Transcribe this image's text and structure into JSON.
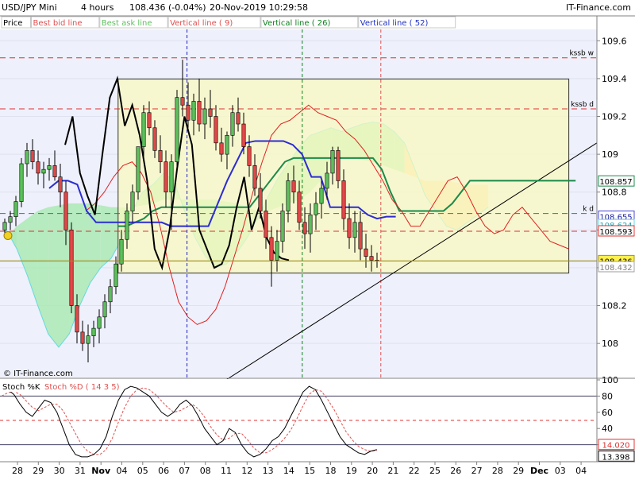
{
  "header": {
    "instrument": "USD/JPY Mini",
    "period": "4 hours",
    "price_change": "108.436 (-0.04%)",
    "datetime": "20-Nov-2019 10:29:58",
    "brand": "IT-Finance.com"
  },
  "legend": {
    "items": [
      {
        "label": "Price",
        "color": "#000000"
      },
      {
        "label": "Best bid line",
        "color": "#e05050"
      },
      {
        "label": "Best ask line",
        "color": "#60c060"
      },
      {
        "label": "Vertical line ( 9)",
        "color": "#e05050"
      },
      {
        "label": "Vertical line ( 26)",
        "color": "#108020"
      },
      {
        "label": "Vertical line ( 52)",
        "color": "#2030c0"
      }
    ]
  },
  "watermark": "© IT-Finance.com",
  "osc_legend": {
    "k_label": "Stoch %K",
    "d_label": "Stoch %D ( 14 3 5)"
  },
  "colors": {
    "plot_bg": "#eef0fb",
    "box_fill": "#fafac0",
    "box_stroke": "#333333",
    "bull": "#5cbf5c",
    "bear": "#e04848",
    "tenkan": "#e02020",
    "kijun": "#1a8a4a",
    "senkou_fill": "#a8e8b0",
    "senkou_fill_bear": "#fbd7a0",
    "chikou": "#000000",
    "span_line": "#66d9e0",
    "blue_line": "#2d2dd0",
    "current_price_line": "#a09020"
  },
  "chart_data": {
    "type": "candlestick",
    "price_scale": {
      "ylim": [
        107.82,
        109.66
      ],
      "ticks": [
        108,
        108.2,
        108.4,
        108.6,
        108.8,
        109,
        109.2,
        109.4,
        109.6
      ],
      "tick_labels": [
        "108",
        "108.2",
        "",
        "",
        "108.8",
        "109",
        "109.2",
        "109.4",
        "109.6"
      ]
    },
    "x_labels": [
      "28",
      "29",
      "30",
      "31",
      "Nov",
      "04",
      "05",
      "06",
      "07",
      "08",
      "11",
      "12",
      "13",
      "14",
      "15",
      "18",
      "19",
      "20",
      "21",
      "22",
      "25",
      "26",
      "27",
      "28",
      "29",
      "Dec",
      "03",
      "04"
    ],
    "levels": [
      {
        "label": "kssb w",
        "value": 109.51,
        "color": "#e03030",
        "dash": true
      },
      {
        "label": "kssb d",
        "value": 109.24,
        "color": "#e03030",
        "dash": true
      },
      {
        "label": "k d",
        "value": 108.687,
        "color": "#e03030",
        "dash": true
      },
      {
        "label": "",
        "value": 108.593,
        "color": "#e03030",
        "dash": true
      },
      {
        "label": "",
        "value": 108.436,
        "color": "#a09020",
        "dash": false
      }
    ],
    "price_badges": [
      {
        "text": "108.857",
        "value": 108.857,
        "color": "#ffffff",
        "border": "#1a8a4a",
        "text_color": "#000000"
      },
      {
        "text": "108.655",
        "value": 108.671,
        "color": "#ffffff",
        "border": "#4444d0",
        "text_color": "#2020a0"
      },
      {
        "text": "108.624",
        "value": 108.626,
        "color": "#ffffff",
        "border": "#66d9e0",
        "text_color": "#30a0b0"
      },
      {
        "text": "108.593",
        "value": 108.593,
        "color": "#ffffff",
        "border": "#e03030",
        "text_color": "#000000"
      },
      {
        "text": "108.436",
        "value": 108.436,
        "color": "#fff04a",
        "border": "#a09020",
        "text_color": "#000000"
      },
      {
        "text": "108.432",
        "value": 108.404,
        "color": "#ffffff",
        "border": "#a0a0a0",
        "text_color": "#808080"
      }
    ],
    "current_price": 108.436,
    "vertical_markers": [
      {
        "label": "9",
        "date_index": 26,
        "color": "#2020c0"
      },
      {
        "label": "26",
        "date_index": 48,
        "color": "#108020"
      },
      {
        "label": "52",
        "date_index": 63,
        "color": "#e05050"
      }
    ],
    "rect_zone": {
      "x_from_index": 8,
      "x_to_index": 101,
      "y_from": 108.372,
      "y_to": 109.398
    },
    "trendline": {
      "from": {
        "date_index": 6,
        "value": 107.58
      },
      "to": {
        "date_index": 106,
        "value": 109.06
      }
    },
    "candles": [
      [
        108.6,
        108.66,
        108.57,
        108.64
      ],
      [
        108.64,
        108.7,
        108.6,
        108.67
      ],
      [
        108.67,
        108.78,
        108.62,
        108.75
      ],
      [
        108.75,
        108.98,
        108.72,
        108.95
      ],
      [
        108.95,
        109.06,
        108.88,
        109.02
      ],
      [
        109.02,
        109.08,
        108.92,
        108.96
      ],
      [
        108.96,
        109.02,
        108.84,
        108.9
      ],
      [
        108.9,
        108.96,
        108.82,
        108.92
      ],
      [
        108.92,
        108.98,
        108.86,
        108.94
      ],
      [
        108.94,
        109.02,
        108.86,
        108.88
      ],
      [
        108.88,
        108.95,
        108.72,
        108.8
      ],
      [
        108.8,
        108.86,
        108.52,
        108.6
      ],
      [
        108.6,
        108.64,
        108.16,
        108.2
      ],
      [
        108.2,
        108.26,
        108.0,
        108.06
      ],
      [
        108.06,
        108.12,
        107.96,
        108.0
      ],
      [
        108.0,
        108.1,
        107.9,
        108.04
      ],
      [
        108.04,
        108.12,
        107.98,
        108.08
      ],
      [
        108.08,
        108.18,
        108.0,
        108.14
      ],
      [
        108.14,
        108.26,
        108.08,
        108.22
      ],
      [
        108.22,
        108.34,
        108.16,
        108.3
      ],
      [
        108.3,
        108.46,
        108.26,
        108.42
      ],
      [
        108.42,
        108.6,
        108.38,
        108.55
      ],
      [
        108.55,
        108.74,
        108.5,
        108.7
      ],
      [
        108.7,
        108.84,
        108.64,
        108.8
      ],
      [
        108.8,
        109.0,
        108.76,
        109.04
      ],
      [
        109.04,
        109.26,
        108.98,
        109.22
      ],
      [
        109.22,
        109.28,
        109.1,
        109.14
      ],
      [
        109.14,
        109.18,
        108.98,
        109.02
      ],
      [
        109.02,
        109.1,
        108.9,
        108.96
      ],
      [
        108.96,
        109.02,
        108.72,
        108.8
      ],
      [
        108.8,
        109.0,
        108.6,
        108.96
      ],
      [
        108.96,
        109.34,
        108.92,
        109.3
      ],
      [
        109.3,
        109.5,
        109.2,
        109.26
      ],
      [
        109.26,
        109.38,
        109.14,
        109.18
      ],
      [
        109.18,
        109.32,
        109.1,
        109.28
      ],
      [
        109.28,
        109.4,
        109.12,
        109.16
      ],
      [
        109.16,
        109.3,
        109.08,
        109.24
      ],
      [
        109.24,
        109.34,
        109.14,
        109.2
      ],
      [
        109.2,
        109.26,
        109.02,
        109.06
      ],
      [
        109.06,
        109.14,
        108.96,
        109.0
      ],
      [
        109.0,
        109.12,
        108.92,
        109.1
      ],
      [
        109.1,
        109.26,
        109.04,
        109.22
      ],
      [
        109.22,
        109.3,
        109.12,
        109.16
      ],
      [
        109.16,
        109.22,
        109.0,
        109.04
      ],
      [
        109.04,
        109.1,
        108.88,
        108.94
      ],
      [
        108.94,
        109.0,
        108.78,
        108.82
      ],
      [
        108.82,
        108.9,
        108.66,
        108.7
      ],
      [
        108.7,
        108.76,
        108.5,
        108.56
      ],
      [
        108.56,
        108.62,
        108.3,
        108.44
      ],
      [
        108.44,
        108.6,
        108.38,
        108.54
      ],
      [
        108.54,
        108.74,
        108.48,
        108.7
      ],
      [
        108.7,
        108.9,
        108.64,
        108.86
      ],
      [
        108.86,
        108.94,
        108.74,
        108.8
      ],
      [
        108.8,
        108.86,
        108.6,
        108.64
      ],
      [
        108.64,
        108.72,
        108.5,
        108.58
      ],
      [
        108.58,
        108.74,
        108.48,
        108.68
      ],
      [
        108.68,
        108.8,
        108.6,
        108.74
      ],
      [
        108.74,
        108.86,
        108.66,
        108.82
      ],
      [
        108.82,
        108.96,
        108.76,
        108.9
      ],
      [
        108.9,
        109.04,
        108.84,
        109.02
      ],
      [
        109.02,
        109.04,
        108.82,
        108.86
      ],
      [
        108.86,
        108.92,
        108.6,
        108.66
      ],
      [
        108.66,
        108.74,
        108.5,
        108.56
      ],
      [
        108.56,
        108.7,
        108.48,
        108.64
      ],
      [
        108.64,
        108.7,
        108.44,
        108.5
      ],
      [
        108.5,
        108.58,
        108.4,
        108.46
      ],
      [
        108.46,
        108.52,
        108.38,
        108.44
      ],
      [
        108.44,
        108.48,
        108.4,
        108.436
      ]
    ],
    "tenkan": [
      108.7,
      108.74,
      108.8,
      108.88,
      108.94,
      108.96,
      108.9,
      108.8,
      108.62,
      108.4,
      108.22,
      108.14,
      108.1,
      108.12,
      108.18,
      108.3,
      108.46,
      108.62,
      108.8,
      108.96,
      109.1,
      109.16,
      109.18,
      109.22,
      109.26,
      109.22,
      109.2,
      109.18,
      109.12,
      109.08,
      109.02,
      108.94,
      108.86,
      108.76,
      108.7,
      108.62,
      108.62,
      108.7,
      108.78,
      108.86,
      108.88,
      108.8,
      108.7,
      108.62,
      108.58,
      108.6,
      108.68,
      108.72,
      108.66,
      108.6,
      108.54,
      108.52,
      108.5
    ],
    "kijun": [
      108.62,
      108.62,
      108.64,
      108.66,
      108.7,
      108.72,
      108.72,
      108.72,
      108.72,
      108.72,
      108.72,
      108.72,
      108.72,
      108.72,
      108.72,
      108.72,
      108.78,
      108.84,
      108.9,
      108.96,
      108.98,
      108.98,
      108.98,
      108.98,
      108.98,
      108.98,
      108.98,
      108.98,
      108.98,
      108.98,
      108.92,
      108.8,
      108.7,
      108.7,
      108.7,
      108.7,
      108.7,
      108.7,
      108.74,
      108.8,
      108.86,
      108.86,
      108.86,
      108.86,
      108.86,
      108.86,
      108.86,
      108.86,
      108.86,
      108.86,
      108.86,
      108.86,
      108.86
    ]
  },
  "oscillator": {
    "type": "stochastic",
    "ylim": [
      0,
      100
    ],
    "ticks": [
      0,
      20,
      40,
      60,
      80,
      100
    ],
    "tick_labels": [
      "0",
      "20",
      "40",
      "60",
      "80",
      "100"
    ],
    "levels": [
      {
        "value": 80,
        "color": "#404060",
        "dash": false
      },
      {
        "value": 50,
        "color": "#e03030",
        "dash": true
      },
      {
        "value": 20,
        "color": "#404060",
        "dash": false
      }
    ],
    "badges": [
      {
        "text": "14.020",
        "value": 14.02,
        "border": "#e03030",
        "text_color": "#e03030"
      },
      {
        "text": "13.398",
        "value": 13.4,
        "border": "#000000",
        "text_color": "#000000"
      }
    ],
    "k_values": [
      90,
      88,
      82,
      70,
      60,
      55,
      65,
      75,
      72,
      60,
      40,
      20,
      8,
      5,
      5,
      8,
      15,
      30,
      55,
      75,
      88,
      92,
      90,
      85,
      80,
      70,
      60,
      55,
      60,
      70,
      75,
      68,
      55,
      40,
      30,
      20,
      25,
      40,
      35,
      20,
      10,
      5,
      8,
      15,
      25,
      30,
      40,
      55,
      70,
      85,
      92,
      88,
      75,
      60,
      45,
      30,
      20,
      15,
      10,
      8,
      12,
      14
    ],
    "d_values": [
      80,
      84,
      86,
      82,
      74,
      66,
      62,
      66,
      70,
      70,
      62,
      48,
      34,
      20,
      12,
      8,
      8,
      14,
      28,
      48,
      66,
      80,
      88,
      90,
      88,
      82,
      74,
      66,
      60,
      62,
      66,
      70,
      64,
      54,
      42,
      32,
      26,
      28,
      34,
      34,
      26,
      16,
      10,
      10,
      14,
      20,
      28,
      38,
      52,
      68,
      82,
      88,
      86,
      76,
      64,
      50,
      36,
      26,
      18,
      14,
      12,
      13
    ]
  }
}
